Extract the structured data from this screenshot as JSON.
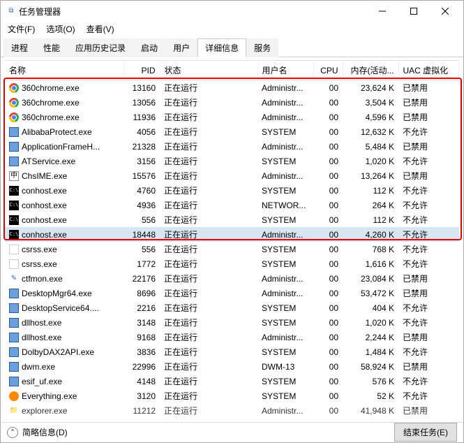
{
  "window": {
    "title": "任务管理器"
  },
  "menu": {
    "file": "文件(F)",
    "options": "选项(O)",
    "view": "查看(V)"
  },
  "tabs": [
    "进程",
    "性能",
    "应用历史记录",
    "启动",
    "用户",
    "详细信息",
    "服务"
  ],
  "tabs_active_index": 5,
  "columns": {
    "name": "名称",
    "pid": "PID",
    "status": "状态",
    "user": "用户名",
    "cpu": "CPU",
    "memory": "内存(活动...",
    "uac": "UAC 虚拟化"
  },
  "status_running": "正在运行",
  "uac_disabled": "已禁用",
  "uac_notallowed": "不允许",
  "footer": {
    "fewerDetails": "简略信息(D)",
    "endTask": "结束任务(E)"
  },
  "rows": [
    {
      "name": "360chrome.exe",
      "pid": "13160",
      "user": "Administr...",
      "cpu": "00",
      "mem": "23,624 K",
      "uac": "已禁用",
      "icon": "chrome"
    },
    {
      "name": "360chrome.exe",
      "pid": "13056",
      "user": "Administr...",
      "cpu": "00",
      "mem": "3,504 K",
      "uac": "已禁用",
      "icon": "chrome"
    },
    {
      "name": "360chrome.exe",
      "pid": "11936",
      "user": "Administr...",
      "cpu": "00",
      "mem": "4,596 K",
      "uac": "已禁用",
      "icon": "chrome"
    },
    {
      "name": "AlibabaProtect.exe",
      "pid": "4056",
      "user": "SYSTEM",
      "cpu": "00",
      "mem": "12,632 K",
      "uac": "不允许",
      "icon": "app"
    },
    {
      "name": "ApplicationFrameH...",
      "pid": "21328",
      "user": "Administr...",
      "cpu": "00",
      "mem": "5,484 K",
      "uac": "已禁用",
      "icon": "app"
    },
    {
      "name": "ATService.exe",
      "pid": "3156",
      "user": "SYSTEM",
      "cpu": "00",
      "mem": "1,020 K",
      "uac": "不允许",
      "icon": "app"
    },
    {
      "name": "ChsIME.exe",
      "pid": "15576",
      "user": "Administr...",
      "cpu": "00",
      "mem": "13,264 K",
      "uac": "已禁用",
      "icon": "ime"
    },
    {
      "name": "conhost.exe",
      "pid": "4760",
      "user": "SYSTEM",
      "cpu": "00",
      "mem": "112 K",
      "uac": "不允许",
      "icon": "cmd"
    },
    {
      "name": "conhost.exe",
      "pid": "4936",
      "user": "NETWOR...",
      "cpu": "00",
      "mem": "264 K",
      "uac": "不允许",
      "icon": "cmd"
    },
    {
      "name": "conhost.exe",
      "pid": "556",
      "user": "SYSTEM",
      "cpu": "00",
      "mem": "112 K",
      "uac": "不允许",
      "icon": "cmd"
    },
    {
      "name": "conhost.exe",
      "pid": "18448",
      "user": "Administr...",
      "cpu": "00",
      "mem": "4,260 K",
      "uac": "不允许",
      "icon": "cmd",
      "selected": true
    },
    {
      "name": "csrss.exe",
      "pid": "556",
      "user": "SYSTEM",
      "cpu": "00",
      "mem": "768 K",
      "uac": "不允许",
      "icon": "exe"
    },
    {
      "name": "csrss.exe",
      "pid": "1772",
      "user": "SYSTEM",
      "cpu": "00",
      "mem": "1,616 K",
      "uac": "不允许",
      "icon": "exe"
    },
    {
      "name": "ctfmon.exe",
      "pid": "22176",
      "user": "Administr...",
      "cpu": "00",
      "mem": "23,084 K",
      "uac": "已禁用",
      "icon": "ctf"
    },
    {
      "name": "DesktopMgr64.exe",
      "pid": "8696",
      "user": "Administr...",
      "cpu": "00",
      "mem": "53,472 K",
      "uac": "已禁用",
      "icon": "app"
    },
    {
      "name": "DesktopService64....",
      "pid": "2216",
      "user": "SYSTEM",
      "cpu": "00",
      "mem": "404 K",
      "uac": "不允许",
      "icon": "app"
    },
    {
      "name": "dllhost.exe",
      "pid": "3148",
      "user": "SYSTEM",
      "cpu": "00",
      "mem": "1,020 K",
      "uac": "不允许",
      "icon": "app"
    },
    {
      "name": "dllhost.exe",
      "pid": "9168",
      "user": "Administr...",
      "cpu": "00",
      "mem": "2,244 K",
      "uac": "已禁用",
      "icon": "app"
    },
    {
      "name": "DolbyDAX2API.exe",
      "pid": "3836",
      "user": "SYSTEM",
      "cpu": "00",
      "mem": "1,484 K",
      "uac": "不允许",
      "icon": "app"
    },
    {
      "name": "dwm.exe",
      "pid": "22996",
      "user": "DWM-13",
      "cpu": "00",
      "mem": "58,924 K",
      "uac": "已禁用",
      "icon": "app"
    },
    {
      "name": "esif_uf.exe",
      "pid": "4148",
      "user": "SYSTEM",
      "cpu": "00",
      "mem": "576 K",
      "uac": "不允许",
      "icon": "app"
    },
    {
      "name": "Everything.exe",
      "pid": "3120",
      "user": "SYSTEM",
      "cpu": "00",
      "mem": "52 K",
      "uac": "不允许",
      "icon": "ev"
    },
    {
      "name": "explorer.exe",
      "pid": "11212",
      "user": "Administr...",
      "cpu": "00",
      "mem": "41,948 K",
      "uac": "已禁用",
      "icon": "folder",
      "partial": true
    }
  ]
}
